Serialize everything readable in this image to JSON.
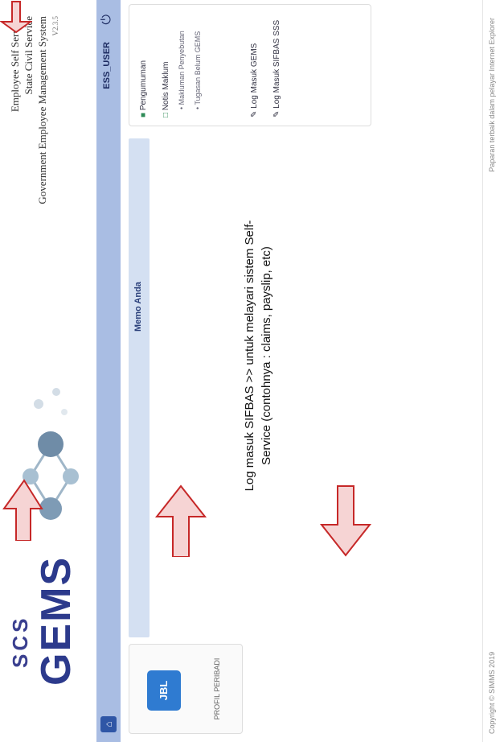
{
  "header": {
    "logo_scs": "SCS",
    "logo_gems": "GEMS",
    "title_line1": "Employee Self Service",
    "title_line2": "State Civil Service",
    "title_line3": "Government Employee Management System",
    "version": "V2.3.5"
  },
  "navbar": {
    "user_label": "ESS_USER"
  },
  "profile": {
    "icon_text": "JBL",
    "label": "PROFIL PERIBADI"
  },
  "memo": {
    "title": "Memo Anda"
  },
  "right_panel": {
    "items": [
      "Pengumuman",
      "Notis Maklum",
      "Makluman Penyebutan",
      "Tugasan Belum GEMS",
      "Log Masuk GEMS",
      "Log Masuk SIFBAS SSS"
    ]
  },
  "instruction": {
    "text": "Log masuk SIFBAS >> untuk melayari sistem Self-Service (contohnya : claims, payslip, etc)"
  },
  "footer": {
    "left": "Copyright © SIMMS 2019",
    "right": "Paparan terbaik dalam pelayar Internet Explorer"
  },
  "colors": {
    "nav": "#a9bde3",
    "arrow": "#c62828",
    "memo_bar": "#d4e0f2"
  }
}
